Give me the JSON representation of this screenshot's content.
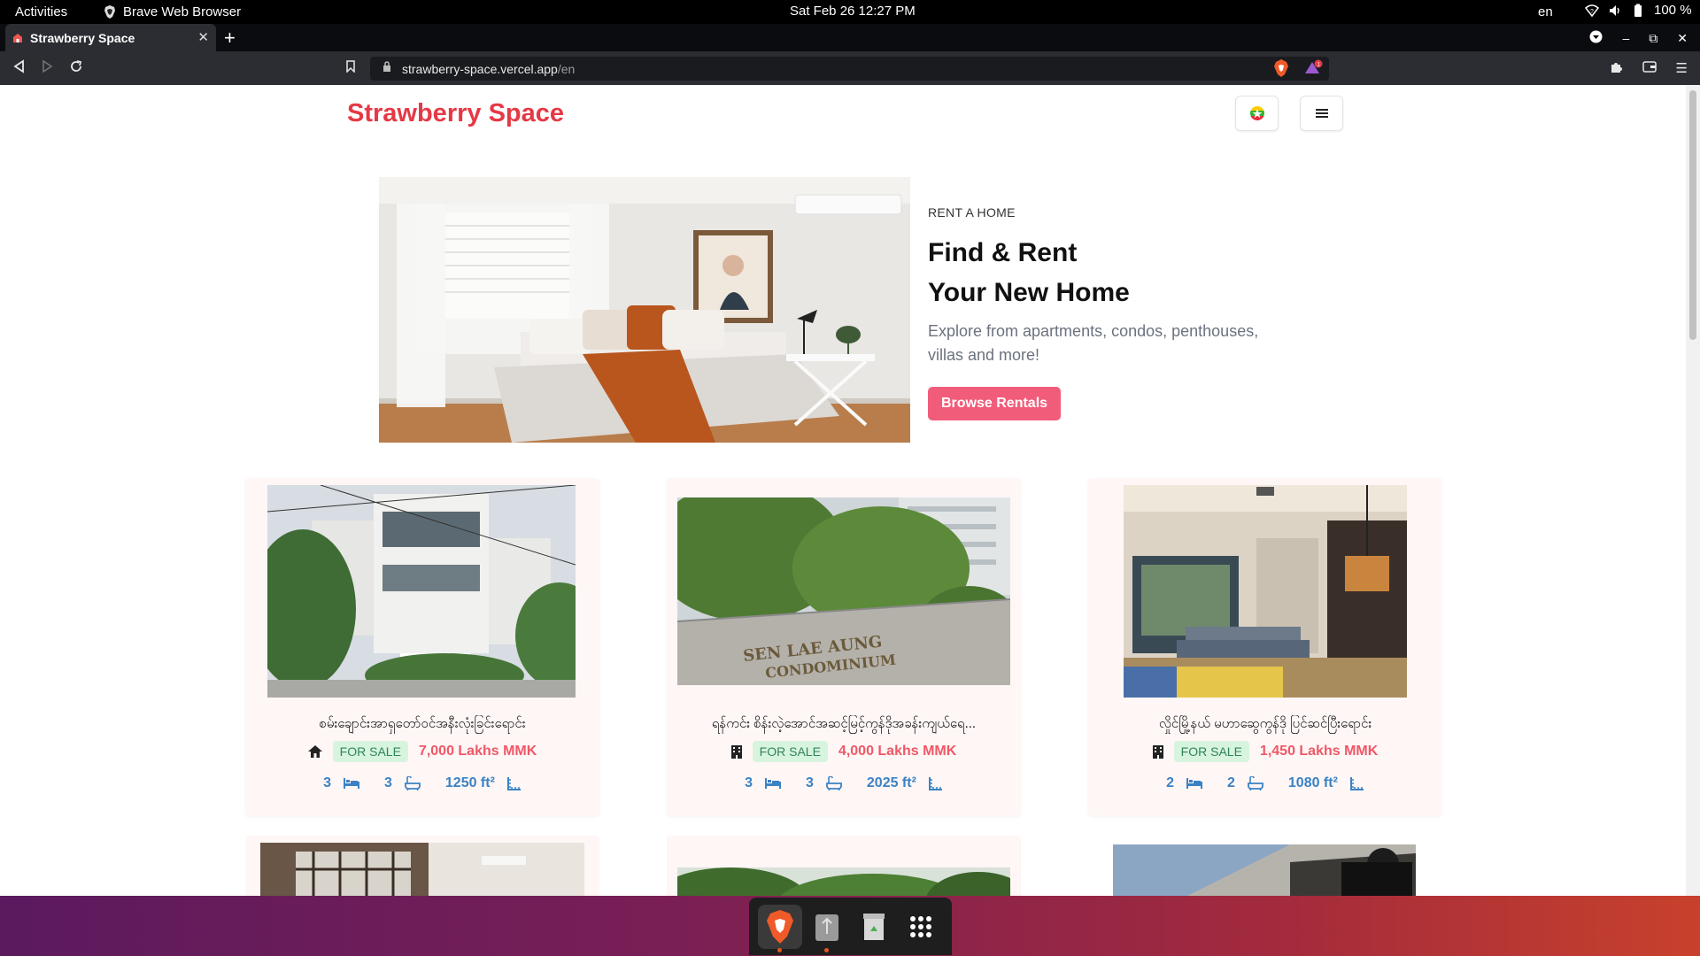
{
  "system_bar": {
    "activities": "Activities",
    "app_name": "Brave Web Browser",
    "clock": "Sat Feb 26  12:27 PM",
    "lang": "en",
    "battery": "100 %"
  },
  "browser": {
    "tab_title": "Strawberry Space",
    "url_host": "strawberry-space.vercel.app",
    "url_path": "/en"
  },
  "header": {
    "logo": "Strawberry Space"
  },
  "hero": {
    "kicker": "RENT A HOME",
    "title_line1": "Find & Rent",
    "title_line2": "Your New Home",
    "description": "Explore from apartments, condos, penthouses, villas and more!",
    "button": "Browse Rentals"
  },
  "listings": [
    {
      "title": "စမ်းချောင်းအာရှတော်ဝင်အနီးလုံးခြင်းရောင်း",
      "type_icon": "house-icon",
      "badge": "FOR SALE",
      "price": "7,000 Lakhs MMK",
      "beds": "3",
      "baths": "3",
      "area": "1250 ft²"
    },
    {
      "title": "ရန်ကင်း စိန်းလဲ့အောင်အဆင့်မြင့်ကွန်ဒိုအခန်းကျယ်ရေ...",
      "type_icon": "building-icon",
      "badge": "FOR SALE",
      "price": "4,000 Lakhs MMK",
      "beds": "3",
      "baths": "3",
      "area": "2025 ft²"
    },
    {
      "title": "လှိုင်မြို့နယ် မဟာဆွေကွန်ဒို ပြင်ဆင်ပြီးရောင်း",
      "type_icon": "building-icon",
      "badge": "FOR SALE",
      "price": "1,450 Lakhs MMK",
      "beds": "2",
      "baths": "2",
      "area": "1080 ft²"
    }
  ],
  "colors": {
    "brand": "#e53945",
    "button": "#f25c7b",
    "badge_bg": "#d7f4df",
    "price": "#ef5866",
    "stat": "#3b82c4"
  }
}
